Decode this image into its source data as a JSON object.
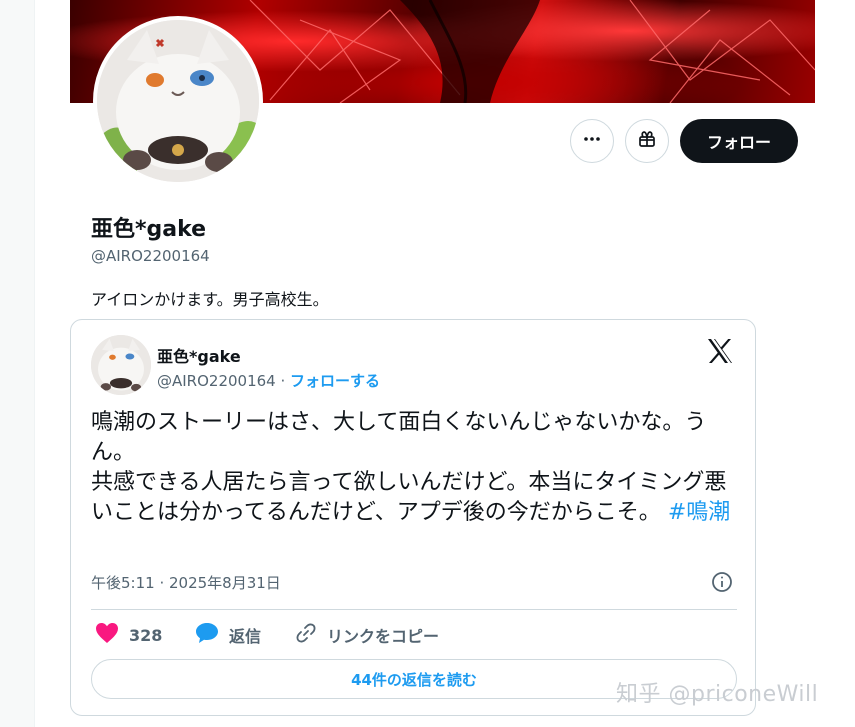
{
  "profile": {
    "display_name": "亜色*gake",
    "handle": "@AIRO2200164",
    "bio": "アイロンかけます。男子高校生。",
    "follow_label": "フォロー"
  },
  "icons": {
    "more": "more-horizontal-icon",
    "gift": "gift-icon",
    "x_logo": "x-logo-icon",
    "info": "info-icon",
    "like": "heart-icon",
    "reply": "chat-bubble-icon",
    "link": "link-icon"
  },
  "embed": {
    "author_name": "亜色*gake",
    "author_handle": "@AIRO2200164",
    "separator": " · ",
    "follow_link": "フォローする",
    "text_main": "鳴潮のストーリーはさ、大して面白くないんじゃないかな。うん。\n共感できる人居たら言って欲しいんだけど。本当にタイミング悪いことは分かってるんだけど、アプデ後の今だからこそ。",
    "hashtag": "#鳴潮",
    "timestamp": "午後5:11 · 2025年8月31日",
    "like_count": "328",
    "reply_label": "返信",
    "copy_link_label": "リンクをコピー",
    "read_replies_label": "44件の返信を読む"
  },
  "watermark": "知乎 @priconeWill",
  "colors": {
    "accent": "#1d9bf0",
    "like": "#f91880",
    "text": "#0f1419",
    "muted": "#536471",
    "border": "#cfd9de"
  }
}
